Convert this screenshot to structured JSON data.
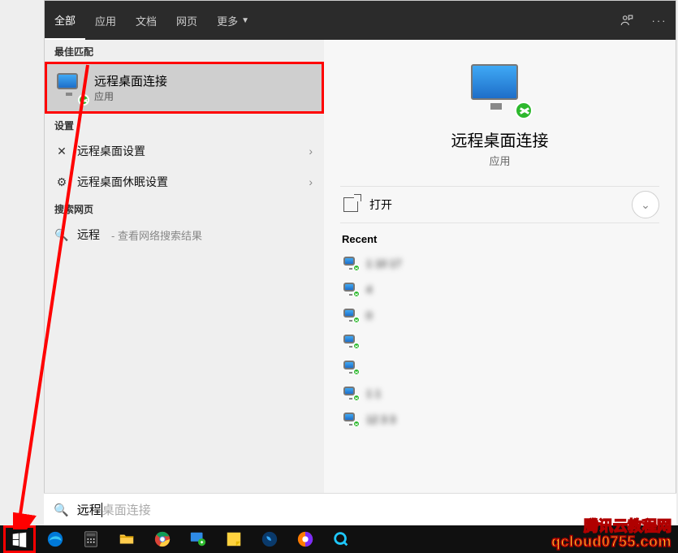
{
  "tabs": {
    "all": "全部",
    "apps": "应用",
    "docs": "文档",
    "web": "网页",
    "more": "更多"
  },
  "sections": {
    "best_match": "最佳匹配",
    "settings": "设置",
    "search_web": "搜索网页"
  },
  "best": {
    "title": "远程桌面连接",
    "subtitle": "应用"
  },
  "settings_items": [
    {
      "icon": "✕",
      "label": "远程桌面设置"
    },
    {
      "icon": "⚙",
      "label": "远程桌面休眠设置"
    }
  ],
  "web": {
    "query": "远程",
    "hint": "- 查看网络搜索结果"
  },
  "preview": {
    "title": "远程桌面连接",
    "subtitle": "应用",
    "open": "打开",
    "recent_header": "Recent",
    "recent": [
      "1   10     17",
      "           4",
      "0",
      "",
      "",
      "1          1",
      "12      3   3"
    ]
  },
  "search": {
    "typed": "远程",
    "ghost": "桌面连接"
  },
  "watermark": {
    "l1": "腾讯云教程网",
    "l2": "qcloud0755.com"
  }
}
